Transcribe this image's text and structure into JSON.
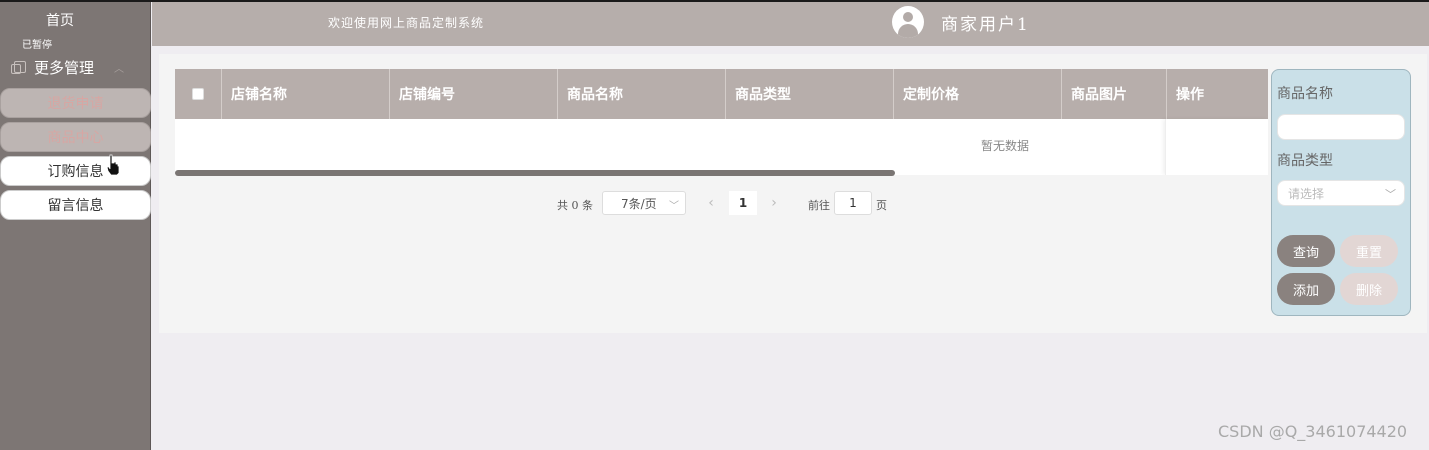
{
  "sidebar": {
    "home_label": "首页",
    "paused_label": "已暂停",
    "more_mgmt_label": "更多管理",
    "items": [
      {
        "label": "退货申请"
      },
      {
        "label": "商品中心"
      },
      {
        "label": "订购信息"
      },
      {
        "label": "留言信息"
      }
    ]
  },
  "header": {
    "welcome": "欢迎使用网上商品定制系统",
    "username": "商家用户1"
  },
  "table": {
    "columns": [
      "店铺名称",
      "店铺编号",
      "商品名称",
      "商品类型",
      "定制价格",
      "商品图片",
      "操作"
    ],
    "rows": [],
    "empty_text": "暂无数据"
  },
  "pagination": {
    "total_label": "共 0 条",
    "page_size_label": "7条/页",
    "prev_icon": "‹",
    "current_page": "1",
    "next_icon": "›",
    "goto_label": "前往",
    "goto_value": "1",
    "page_unit": "页"
  },
  "search_panel": {
    "name_label": "商品名称",
    "name_value": "",
    "type_label": "商品类型",
    "type_placeholder": "请选择",
    "query_button": "查询",
    "reset_button": "重置",
    "add_button": "添加",
    "delete_button": "删除"
  },
  "watermark": "CSDN @Q_3461074420",
  "colors": {
    "sidebar_bg": "#7d7674",
    "header_bg": "#b6aeab",
    "table_header_bg": "#b7aeab",
    "search_panel_bg": "#cae0e8",
    "dark_button": "#8a827f",
    "light_button": "#e2d6d4"
  }
}
